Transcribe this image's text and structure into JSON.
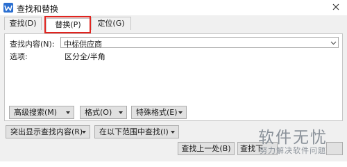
{
  "window": {
    "title": "查找和替换"
  },
  "tabs": [
    {
      "label": "查找(D)",
      "active": false
    },
    {
      "label": "替换(P)",
      "active": true,
      "highlighted": true
    },
    {
      "label": "定位(G)",
      "active": false
    }
  ],
  "find": {
    "label": "查找内容(N):",
    "value": "中标供应商"
  },
  "options": {
    "label": "选项:",
    "value": "区分全/半角"
  },
  "buttons": {
    "advanced_search": "高级搜索(M)",
    "format": "格式(O)",
    "special_format": "特殊格式(E)",
    "highlight": "突出显示查找内容(R)",
    "find_in": "在以下范围中查找(I)",
    "find_prev": "查找上一处(B)",
    "find_next": "查找下"
  },
  "watermark": {
    "main": "软件无忧",
    "sub": "努力解决软件问题"
  },
  "colors": {
    "highlight_border": "#e0241f",
    "app_icon": "#2b6fd1"
  }
}
